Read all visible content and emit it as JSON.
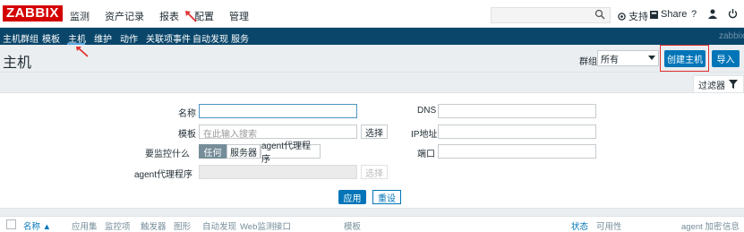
{
  "header": {
    "logo": "ZABBIX",
    "nav": [
      "监测",
      "资产记录",
      "报表",
      "配置",
      "管理"
    ],
    "support": "支持",
    "share": "Share",
    "help": "?"
  },
  "subnav": {
    "items": [
      "主机群组",
      "模板",
      "主机",
      "维护",
      "动作",
      "关联项事件",
      "自动发现",
      "服务"
    ],
    "right": "zabbix"
  },
  "page": {
    "title": "主机",
    "group_label": "群组",
    "group_value": "所有",
    "create_host": "创建主机",
    "import": "导入"
  },
  "filter": {
    "tab_label": "过滤器",
    "name_label": "名称",
    "template_label": "模板",
    "template_placeholder": "在此输入搜索",
    "select_label": "选择",
    "monitor_label": "要监控什么",
    "monitor_options": [
      "任何",
      "服务器",
      "agent代理程序"
    ],
    "proxy_label": "agent代理程序",
    "proxy_select": "选择",
    "dns_label": "DNS",
    "ip_label": "IP地址",
    "port_label": "端口",
    "apply": "应用",
    "reset": "重设"
  },
  "table": {
    "columns": [
      "名称 ▲",
      "应用集",
      "监控项",
      "触发器",
      "图形",
      "自动发现",
      "Web监测",
      "接口",
      "模板",
      "状态",
      "可用性",
      "agent 加密",
      "信息"
    ]
  },
  "colors": {
    "logo": "#d40000",
    "subnav_bg": "#0a466a",
    "button_blue": "#0275b8",
    "highlight_red": "#e03030"
  }
}
